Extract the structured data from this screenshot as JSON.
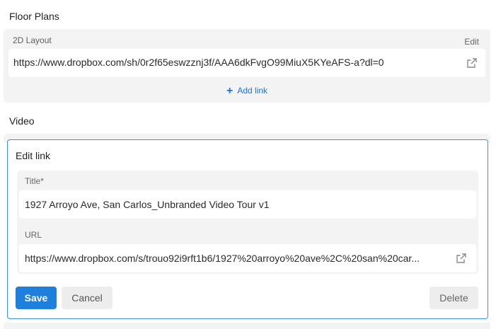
{
  "floor_plans": {
    "section_title": "Floor Plans",
    "link_label": "2D Layout",
    "edit_label": "Edit",
    "url": "https://www.dropbox.com/sh/0r2f65eswzznj3f/AAA6dkFvgO99MiuX5KYeAFS-a?dl=0",
    "open_icon": "external-link-icon",
    "add_link_label": "Add link",
    "add_icon": "plus-icon"
  },
  "video": {
    "section_title": "Video",
    "edit_panel": {
      "heading": "Edit link",
      "title_label": "Title*",
      "title_value": "1927 Arroyo Ave, San Carlos_Unbranded Video Tour v1",
      "url_label": "URL",
      "url_value": "https://www.dropbox.com/s/trouo92i9rft1b6/1927%20arroyo%20ave%2C%20san%20car...",
      "open_icon": "external-link-icon",
      "save_label": "Save",
      "cancel_label": "Cancel",
      "delete_label": "Delete"
    }
  },
  "colors": {
    "accent": "#1e7fdc",
    "panel_border": "#3d8fdc",
    "card_bg": "#f3f3f3"
  }
}
